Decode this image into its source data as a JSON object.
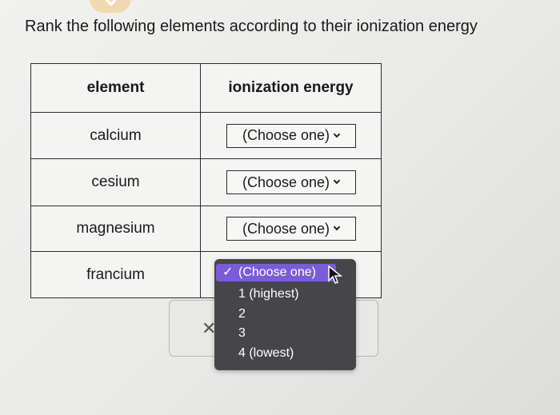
{
  "prompt": "Rank the following elements according to their ionization energy",
  "table": {
    "headers": [
      "element",
      "ionization energy"
    ],
    "rows": [
      {
        "element": "calcium",
        "value": "(Choose one)"
      },
      {
        "element": "cesium",
        "value": "(Choose one)"
      },
      {
        "element": "magnesium",
        "value": "(Choose one)"
      },
      {
        "element": "francium",
        "value": "(Choose one)"
      }
    ]
  },
  "dropdown": {
    "selected": "(Choose one)",
    "options": [
      "1 (highest)",
      "2",
      "3",
      "4 (lowest)"
    ],
    "highlight_color": "#7b5cd8"
  },
  "icons": {
    "check": "checkmark-icon",
    "close": "close-icon",
    "cursor": "mouse-pointer-icon"
  }
}
